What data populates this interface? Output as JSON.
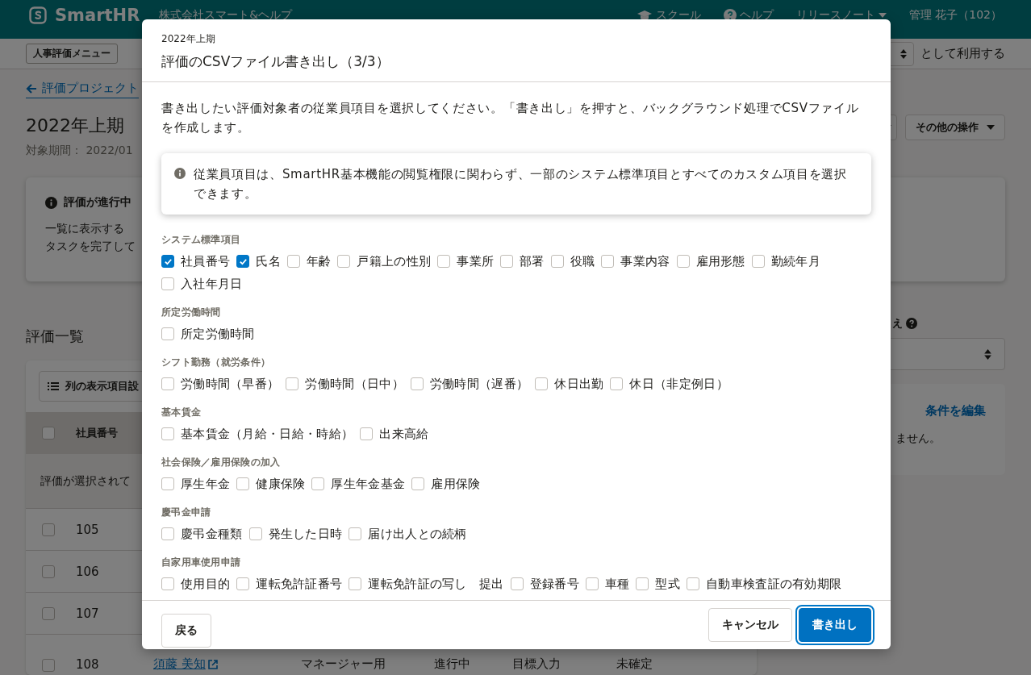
{
  "header": {
    "logo": "SmartHR",
    "company": "株式会社スマート&ヘルプ",
    "links": [
      {
        "kind": "school",
        "label": "スクール"
      },
      {
        "kind": "help",
        "label": "ヘルプ"
      },
      {
        "kind": "dropdown",
        "label": "リリースノート"
      }
    ],
    "user": "管理 花子（102）"
  },
  "subbar": {
    "menu_button": "人事評価メニュー",
    "role_suffix": "として利用する"
  },
  "page": {
    "back_link": "評価プロジェクト",
    "title": "2022年上期",
    "period": "対象期間： 2022/01",
    "more_button": "その他の操作",
    "notice": {
      "title": "評価が進行中",
      "lines": [
        "一覧に表示する",
        "タスクを完了して"
      ]
    },
    "list_title": "評価一覧",
    "columns_button": "列の表示項目設",
    "table": {
      "header": "社員番号",
      "header_checked": false,
      "selection_note": "評価が選択されて",
      "rows": [
        {
          "number": "105",
          "checked": false
        },
        {
          "number": "106",
          "checked": false
        },
        {
          "number": "107",
          "checked": false
        },
        {
          "number": "108",
          "checked": false,
          "name": "須藤 美知",
          "cells": [
            "マネージャー用",
            "進行中",
            "目標入力",
            "未確定"
          ]
        }
      ]
    }
  },
  "side": {
    "label": "え",
    "edit_link": "条件を編集",
    "message": "ません。"
  },
  "modal": {
    "period": "2022年上期",
    "title": "評価のCSVファイル書き出し（3/3）",
    "description": "書き出したい評価対象者の従業員項目を選択してください。「書き出し」を押すと、バックグラウンド処理でCSVファイルを作成します。",
    "info": "従業員項目は、SmartHR基本機能の閲覧権限に関わらず、一部のシステム標準項目とすべてのカスタム項目を選択できます。",
    "groups": [
      {
        "title": "システム標準項目",
        "items": [
          {
            "label": "社員番号",
            "checked": true
          },
          {
            "label": "氏名",
            "checked": true
          },
          {
            "label": "年齢",
            "checked": false
          },
          {
            "label": "戸籍上の性別",
            "checked": false
          },
          {
            "label": "事業所",
            "checked": false
          },
          {
            "label": "部署",
            "checked": false
          },
          {
            "label": "役職",
            "checked": false
          },
          {
            "label": "事業内容",
            "checked": false
          },
          {
            "label": "雇用形態",
            "checked": false
          },
          {
            "label": "勤続年月",
            "checked": false
          },
          {
            "label": "入社年月日",
            "checked": false
          }
        ]
      },
      {
        "title": "所定労働時間",
        "items": [
          {
            "label": "所定労働時間",
            "checked": false
          }
        ]
      },
      {
        "title": "シフト勤務（就労条件）",
        "items": [
          {
            "label": "労働時間（早番）",
            "checked": false
          },
          {
            "label": "労働時間（日中）",
            "checked": false
          },
          {
            "label": "労働時間（遅番）",
            "checked": false
          },
          {
            "label": "休日出勤",
            "checked": false
          },
          {
            "label": "休日（非定例日）",
            "checked": false
          }
        ]
      },
      {
        "title": "基本賃金",
        "items": [
          {
            "label": "基本賃金（月給・日給・時給）",
            "checked": false
          },
          {
            "label": "出来高給",
            "checked": false
          }
        ]
      },
      {
        "title": "社会保険／雇用保険の加入",
        "items": [
          {
            "label": "厚生年金",
            "checked": false
          },
          {
            "label": "健康保険",
            "checked": false
          },
          {
            "label": "厚生年金基金",
            "checked": false
          },
          {
            "label": "雇用保険",
            "checked": false
          }
        ]
      },
      {
        "title": "慶弔金申請",
        "items": [
          {
            "label": "慶弔金種類",
            "checked": false
          },
          {
            "label": "発生した日時",
            "checked": false
          },
          {
            "label": "届け出人との続柄",
            "checked": false
          }
        ]
      },
      {
        "title": "自家用車使用申請",
        "items": [
          {
            "label": "使用目的",
            "checked": false
          },
          {
            "label": "運転免許証番号",
            "checked": false
          },
          {
            "label": "運転免許証の写し　提出",
            "checked": false
          },
          {
            "label": "登録番号",
            "checked": false
          },
          {
            "label": "車種",
            "checked": false
          },
          {
            "label": "型式",
            "checked": false
          },
          {
            "label": "自動車検査証の有効期限",
            "checked": false
          }
        ]
      }
    ],
    "buttons": [
      {
        "kind": "back",
        "label": "戻る"
      },
      {
        "kind": "cancel",
        "label": "キャンセル"
      },
      {
        "kind": "submit",
        "label": "書き出し"
      }
    ]
  }
}
